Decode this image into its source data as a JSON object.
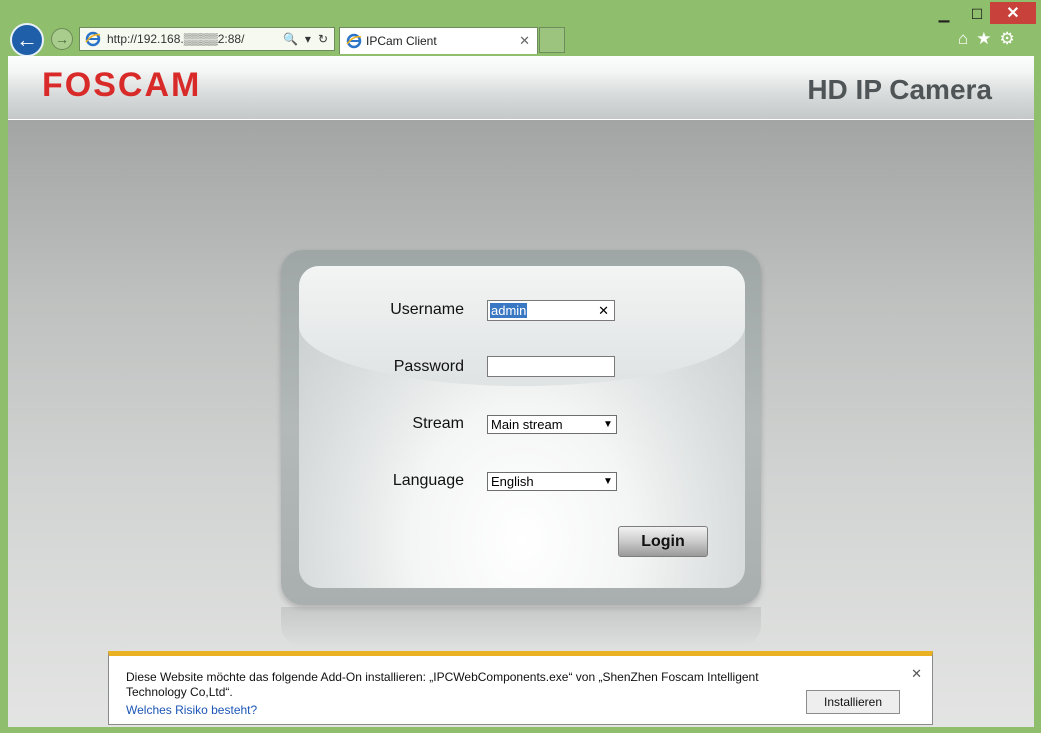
{
  "window": {
    "min_label": "▁",
    "max_label": "☐",
    "close_label": "✕"
  },
  "nav": {
    "url": "http://192.168.▒▒▒▒2:88/",
    "search_icon": "🔍",
    "dropdown_icon": "▾",
    "refresh_icon": "↻"
  },
  "tab": {
    "title": "IPCam Client",
    "close": "✕"
  },
  "toolbar": {
    "home_icon": "⌂",
    "star_icon": "★",
    "gear_icon": "⚙"
  },
  "header": {
    "logo": "FOSCAM",
    "title": "HD IP Camera"
  },
  "login": {
    "username_label": "Username",
    "username_value": "admin",
    "password_label": "Password",
    "password_value": "",
    "stream_label": "Stream",
    "stream_value": "Main stream",
    "language_label": "Language",
    "language_value": "English",
    "login_label": "Login"
  },
  "notification": {
    "message": "Diese Website möchte das folgende Add-On installieren: „IPCWebComponents.exe“ von „ShenZhen Foscam Intelligent Technology Co,Ltd“.",
    "risk_link": "Welches Risiko besteht?",
    "install_label": "Installieren",
    "close": "✕"
  },
  "colors": {
    "accent_red": "#d92a2a",
    "frame_green": "#8fbf6c",
    "notif_bar": "#eab223"
  }
}
